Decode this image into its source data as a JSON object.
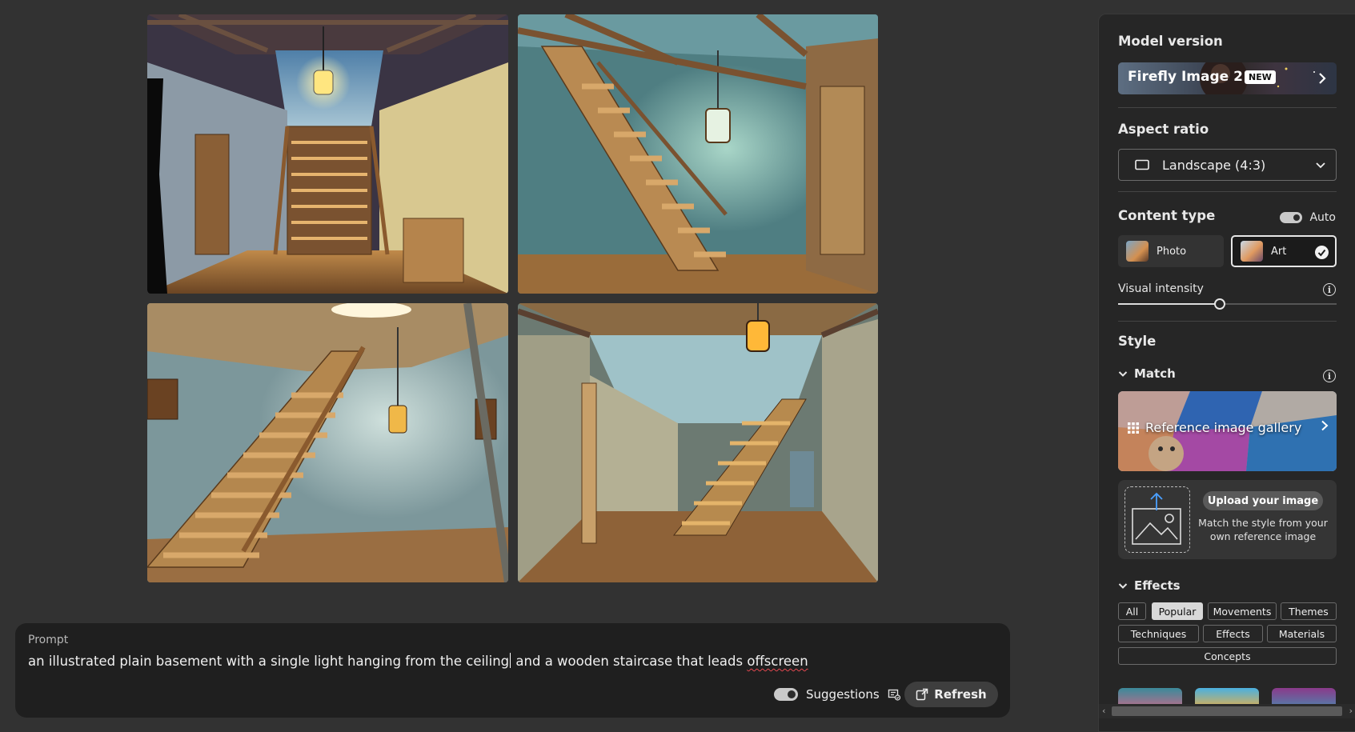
{
  "grid": {
    "images": [
      {
        "alt": "basement-staircase-1"
      },
      {
        "alt": "basement-staircase-2"
      },
      {
        "alt": "basement-staircase-3"
      },
      {
        "alt": "basement-staircase-4"
      }
    ]
  },
  "prompt": {
    "label": "Prompt",
    "text_before_caret": "an illustrated plain basement with a single light hanging from the ceiling",
    "text_after_caret": " and a wooden staircase that leads ",
    "misspelled_word": "offscreen",
    "suggestions_label": "Suggestions",
    "suggestions_on": true,
    "refresh_label": "Refresh"
  },
  "panel": {
    "model_version": {
      "heading": "Model version",
      "name": "Firefly Image 2",
      "badge": "NEW"
    },
    "aspect_ratio": {
      "heading": "Aspect ratio",
      "value": "Landscape (4:3)"
    },
    "content_type": {
      "heading": "Content type",
      "auto_label": "Auto",
      "auto_on": true,
      "options": [
        {
          "label": "Photo",
          "selected": false
        },
        {
          "label": "Art",
          "selected": true
        }
      ]
    },
    "visual_intensity": {
      "label": "Visual intensity",
      "value_fraction": 0.46
    },
    "style": {
      "heading": "Style",
      "match_label": "Match",
      "gallery_label": "Reference image gallery",
      "upload_button": "Upload your image",
      "upload_description": "Match the style from your own reference image"
    },
    "effects": {
      "heading": "Effects",
      "chips_row1": [
        "All",
        "Popular",
        "Movements",
        "Themes"
      ],
      "chips_row2": [
        "Techniques",
        "Effects",
        "Materials"
      ],
      "chips_row3": [
        "Concepts"
      ],
      "active_chip": "Popular"
    }
  },
  "colors": {
    "background": "#323232",
    "panel": "#262626",
    "prompt_bg": "#1f1f1f",
    "misspelling": "#e34850"
  }
}
